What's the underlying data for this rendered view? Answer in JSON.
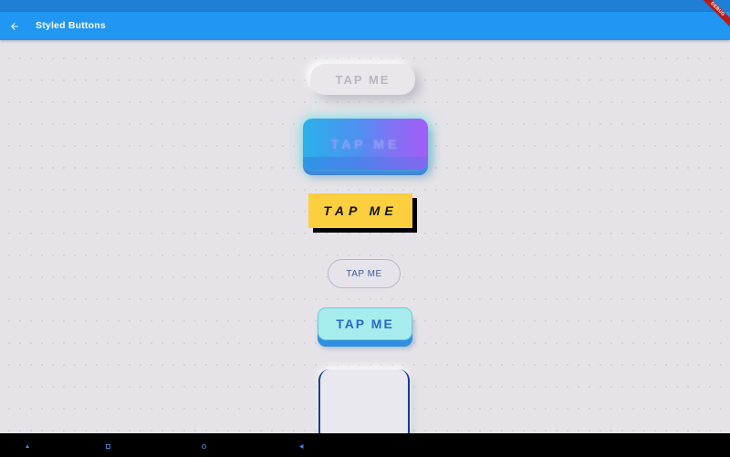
{
  "app_bar": {
    "title": "Styled Buttons",
    "back_icon": "arrow-back-icon",
    "background": "#2196f3"
  },
  "debug_banner": {
    "label": "DEBUG"
  },
  "buttons": [
    {
      "label": "TAP ME",
      "style": "neumorphic"
    },
    {
      "label": "TAP ME",
      "style": "glowing-gradient"
    },
    {
      "label": "TAP ME",
      "style": "yellow-brutalist"
    },
    {
      "label": "TAP ME",
      "style": "outlined-pill"
    },
    {
      "label": "TAP ME",
      "style": "cyan-3d"
    },
    {
      "label": "",
      "style": "white-card"
    }
  ],
  "nav_bar": {
    "items": [
      "volume-down-icon",
      "overview-icon",
      "home-icon",
      "back-icon"
    ]
  }
}
